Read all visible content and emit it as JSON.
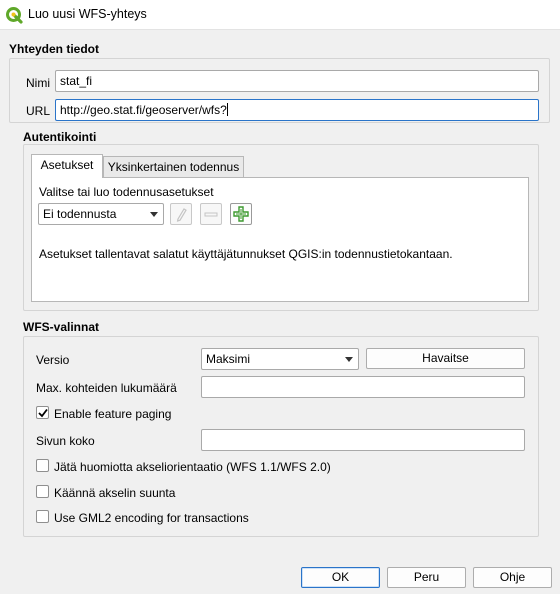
{
  "window": {
    "title": "Luo uusi WFS-yhteys"
  },
  "connection": {
    "section_title": "Yhteyden tiedot",
    "name_label": "Nimi",
    "name_value": "stat_fi",
    "url_label": "URL",
    "url_value": "http://geo.stat.fi/geoserver/wfs?"
  },
  "authentication": {
    "section_title": "Autentikointi",
    "tabs": [
      {
        "label": "Asetukset",
        "active": true
      },
      {
        "label": "Yksinkertainen todennus",
        "active": false
      }
    ],
    "select_label": "Valitse tai luo todennusasetukset",
    "config_value": "Ei todennusta",
    "note": "Asetukset tallentavat salatut käyttäjätunnukset QGIS:in todennustietokantaan.",
    "icons": [
      "pencil-icon",
      "minus-icon",
      "plus-icon"
    ]
  },
  "wfs": {
    "section_title": "WFS-valinnat",
    "version_label": "Versio",
    "version_value": "Maksimi",
    "detect_label": "Havaitse",
    "max_features_label": "Max. kohteiden lukumäärä",
    "max_features_value": "",
    "paging_label": "Enable feature paging",
    "paging_checked": true,
    "page_size_label": "Sivun koko",
    "page_size_value": "",
    "ignore_axis_label": "Jätä huomiotta akseliorientaatio (WFS 1.1/WFS 2.0)",
    "ignore_axis_checked": false,
    "invert_axis_label": "Käännä akselin suunta",
    "invert_axis_checked": false,
    "gml2_label": "Use GML2 encoding for transactions",
    "gml2_checked": false
  },
  "buttons": {
    "ok": "OK",
    "cancel": "Peru",
    "help": "Ohje"
  },
  "colors": {
    "accent": "#2a74c9",
    "qgis_green": "#5fa829",
    "add_green": "#3c9a2e"
  }
}
